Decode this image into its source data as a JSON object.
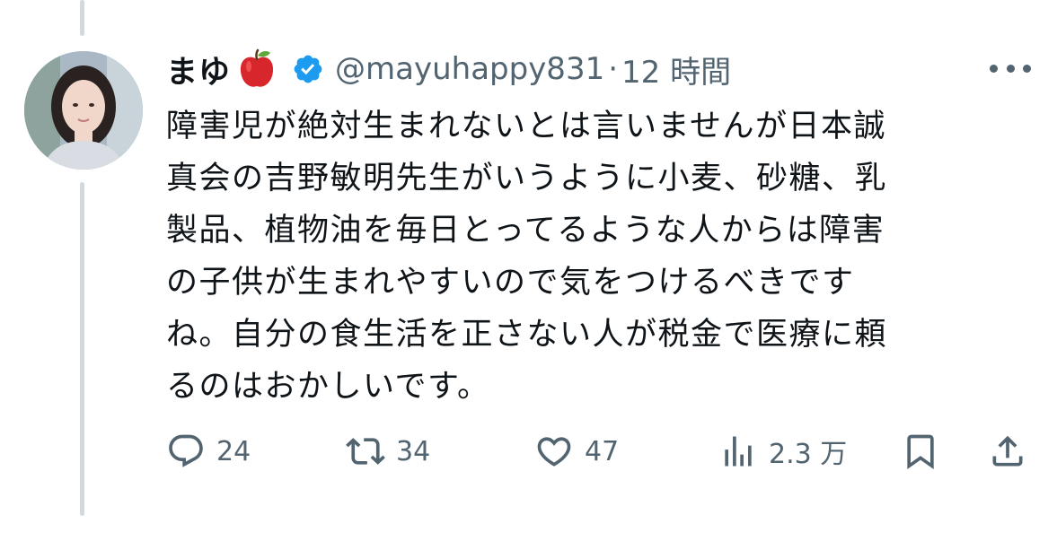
{
  "tweet": {
    "display_name": "まゆ",
    "name_emoji": "apple-emoji",
    "verified_icon": "verified-badge-icon",
    "handle": "@mayuhappy831",
    "separator": "·",
    "time": "12 時間",
    "text": "障害児が絶対生まれないとは言いませんが日本誠\n真会の吉野敏明先生がいうように小麦、砂糖、乳\n製品、植物油を毎日とってるような人からは障害\nの子供が生まれやすいので気をつけるべきです\nね。自分の食生活を正さない人が税金で医療に頼\nるのはおかしいです。"
  },
  "actions": {
    "reply": {
      "icon": "reply-icon",
      "count": "24"
    },
    "retweet": {
      "icon": "retweet-icon",
      "count": "34"
    },
    "like": {
      "icon": "heart-icon",
      "count": "47"
    },
    "views": {
      "icon": "views-bar-chart-icon",
      "count": "2.3 万"
    },
    "bookmark": {
      "icon": "bookmark-icon"
    },
    "share": {
      "icon": "share-icon"
    }
  },
  "colors": {
    "text": "#0f1419",
    "secondary": "#536471",
    "verified": "#1d9bf0",
    "thread_line": "#cfd9de"
  }
}
